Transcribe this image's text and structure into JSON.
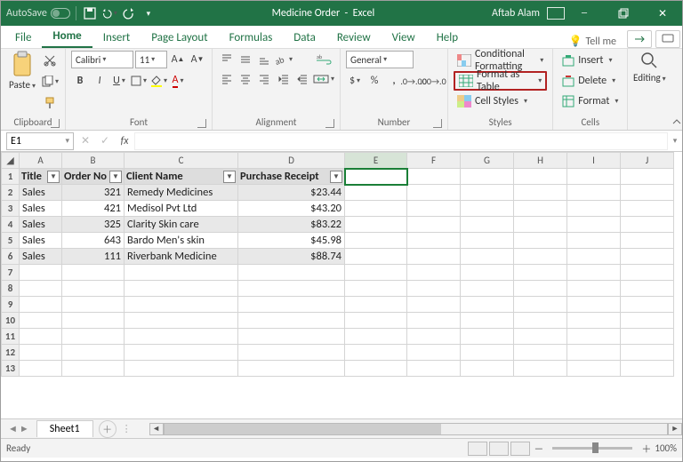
{
  "title": {
    "autosave": "AutoSave",
    "docname": "Medicine Order",
    "appname": "Excel",
    "user": "Aftab Alam"
  },
  "menu": {
    "tabs": [
      "File",
      "Home",
      "Insert",
      "Page Layout",
      "Formulas",
      "Data",
      "Review",
      "View",
      "Help"
    ],
    "active": "Home",
    "tellme": "Tell me"
  },
  "ribbon": {
    "clipboard": {
      "paste": "Paste",
      "label": "Clipboard"
    },
    "font": {
      "name": "Calibri",
      "size": "11",
      "label": "Font"
    },
    "alignment": {
      "label": "Alignment"
    },
    "number": {
      "format": "General",
      "label": "Number"
    },
    "styles": {
      "conditional": "Conditional Formatting",
      "format_table": "Format as Table",
      "cell_styles": "Cell Styles",
      "label": "Styles"
    },
    "cells": {
      "insert": "Insert",
      "delete": "Delete",
      "format": "Format",
      "label": "Cells"
    },
    "editing": {
      "label": "Editing"
    }
  },
  "namebox": "E1",
  "grid": {
    "cols": [
      "A",
      "B",
      "C",
      "D",
      "E",
      "F",
      "G",
      "H",
      "I",
      "J"
    ],
    "headers": [
      "Title",
      "Order No",
      "Client Name",
      "Purchase Receipt"
    ],
    "rows": [
      {
        "title": "Sales",
        "order_no": 321,
        "client": "Remedy Medicines",
        "receipt": "$23.44"
      },
      {
        "title": "Sales",
        "order_no": 421,
        "client": "Medisol Pvt Ltd",
        "receipt": "$43.20"
      },
      {
        "title": "Sales",
        "order_no": 325,
        "client": "Clarity Skin care",
        "receipt": "$83.22"
      },
      {
        "title": "Sales",
        "order_no": 643,
        "client": "Bardo Men's skin",
        "receipt": "$45.98"
      },
      {
        "title": "Sales",
        "order_no": 111,
        "client": "Riverbank Medicine",
        "receipt": "$88.74"
      }
    ],
    "selected_cell": "E1"
  },
  "tabs": {
    "sheet": "Sheet1"
  },
  "status": {
    "ready": "Ready",
    "zoom": "100%"
  }
}
